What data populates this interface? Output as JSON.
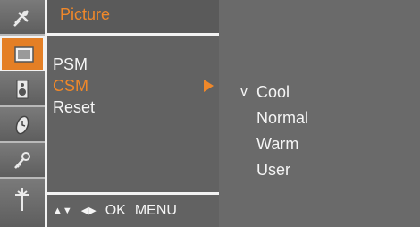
{
  "sidebar": {
    "icons": [
      {
        "name": "satellite-icon"
      },
      {
        "name": "picture-icon"
      },
      {
        "name": "audio-speaker-icon"
      },
      {
        "name": "clock-icon"
      },
      {
        "name": "key-icon"
      },
      {
        "name": "input-antenna-icon"
      }
    ],
    "active_index": 1
  },
  "menu": {
    "title": "Picture",
    "items": [
      {
        "label": "PSM"
      },
      {
        "label": "CSM"
      },
      {
        "label": "Reset"
      }
    ],
    "selected_index": 1
  },
  "submenu": {
    "check_mark": "v",
    "items": [
      {
        "label": "Cool"
      },
      {
        "label": "Normal"
      },
      {
        "label": "Warm"
      },
      {
        "label": "User"
      }
    ],
    "checked_index": 0
  },
  "hints": {
    "updown": "▲▼",
    "leftright": "◀▶",
    "ok": "OK",
    "menu": "MENU"
  },
  "colors": {
    "accent": "#f0882a",
    "panel": "#626262",
    "text": "#f5f5f5"
  }
}
